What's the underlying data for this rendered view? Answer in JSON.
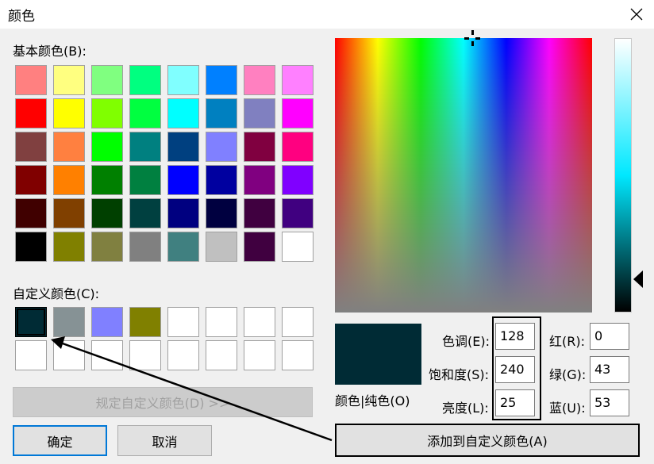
{
  "window": {
    "title": "颜色"
  },
  "basic": {
    "label": "基本颜色(B):",
    "colors": [
      "#ff8080",
      "#ffff80",
      "#80ff80",
      "#00ff80",
      "#80ffff",
      "#0080ff",
      "#ff80c0",
      "#ff80ff",
      "#ff0000",
      "#ffff00",
      "#80ff00",
      "#00ff40",
      "#00ffff",
      "#0080c0",
      "#8080c0",
      "#ff00ff",
      "#804040",
      "#ff8040",
      "#00ff00",
      "#008080",
      "#004080",
      "#8080ff",
      "#800040",
      "#ff0080",
      "#800000",
      "#ff8000",
      "#008000",
      "#008040",
      "#0000ff",
      "#0000a0",
      "#800080",
      "#8000ff",
      "#400000",
      "#804000",
      "#004000",
      "#004040",
      "#000080",
      "#000040",
      "#400040",
      "#400080",
      "#000000",
      "#808000",
      "#808040",
      "#808080",
      "#408080",
      "#c0c0c0",
      "#400040",
      "#ffffff"
    ]
  },
  "custom": {
    "label": "自定义颜色(C):",
    "colors": [
      "#002b35",
      "#869295",
      "#8080ff",
      "#808000",
      "#ffffff",
      "#ffffff",
      "#ffffff",
      "#ffffff",
      "#ffffff",
      "#ffffff",
      "#ffffff",
      "#ffffff",
      "#ffffff",
      "#ffffff",
      "#ffffff",
      "#ffffff"
    ],
    "selected": 0
  },
  "buttons": {
    "define_custom": "规定自定义颜色(D) >>",
    "ok": "确定",
    "cancel": "取消",
    "add_custom": "添加到自定义颜色(A)"
  },
  "preview": {
    "label": "颜色|纯色(O)",
    "color": "#002b35"
  },
  "hsl": {
    "hue_label": "色调(E):",
    "hue": "128",
    "sat_label": "饱和度(S):",
    "sat": "240",
    "lum_label": "亮度(L):",
    "lum": "25"
  },
  "rgb": {
    "red_label": "红(R):",
    "red": "0",
    "green_label": "绿(G):",
    "green": "43",
    "blue_label": "蓝(U):",
    "blue": "53"
  },
  "luminance_pointer_level": 0.88,
  "spectrum_crosshair": {
    "hue_fraction": 0.533,
    "saturation_fraction": 1.0
  }
}
